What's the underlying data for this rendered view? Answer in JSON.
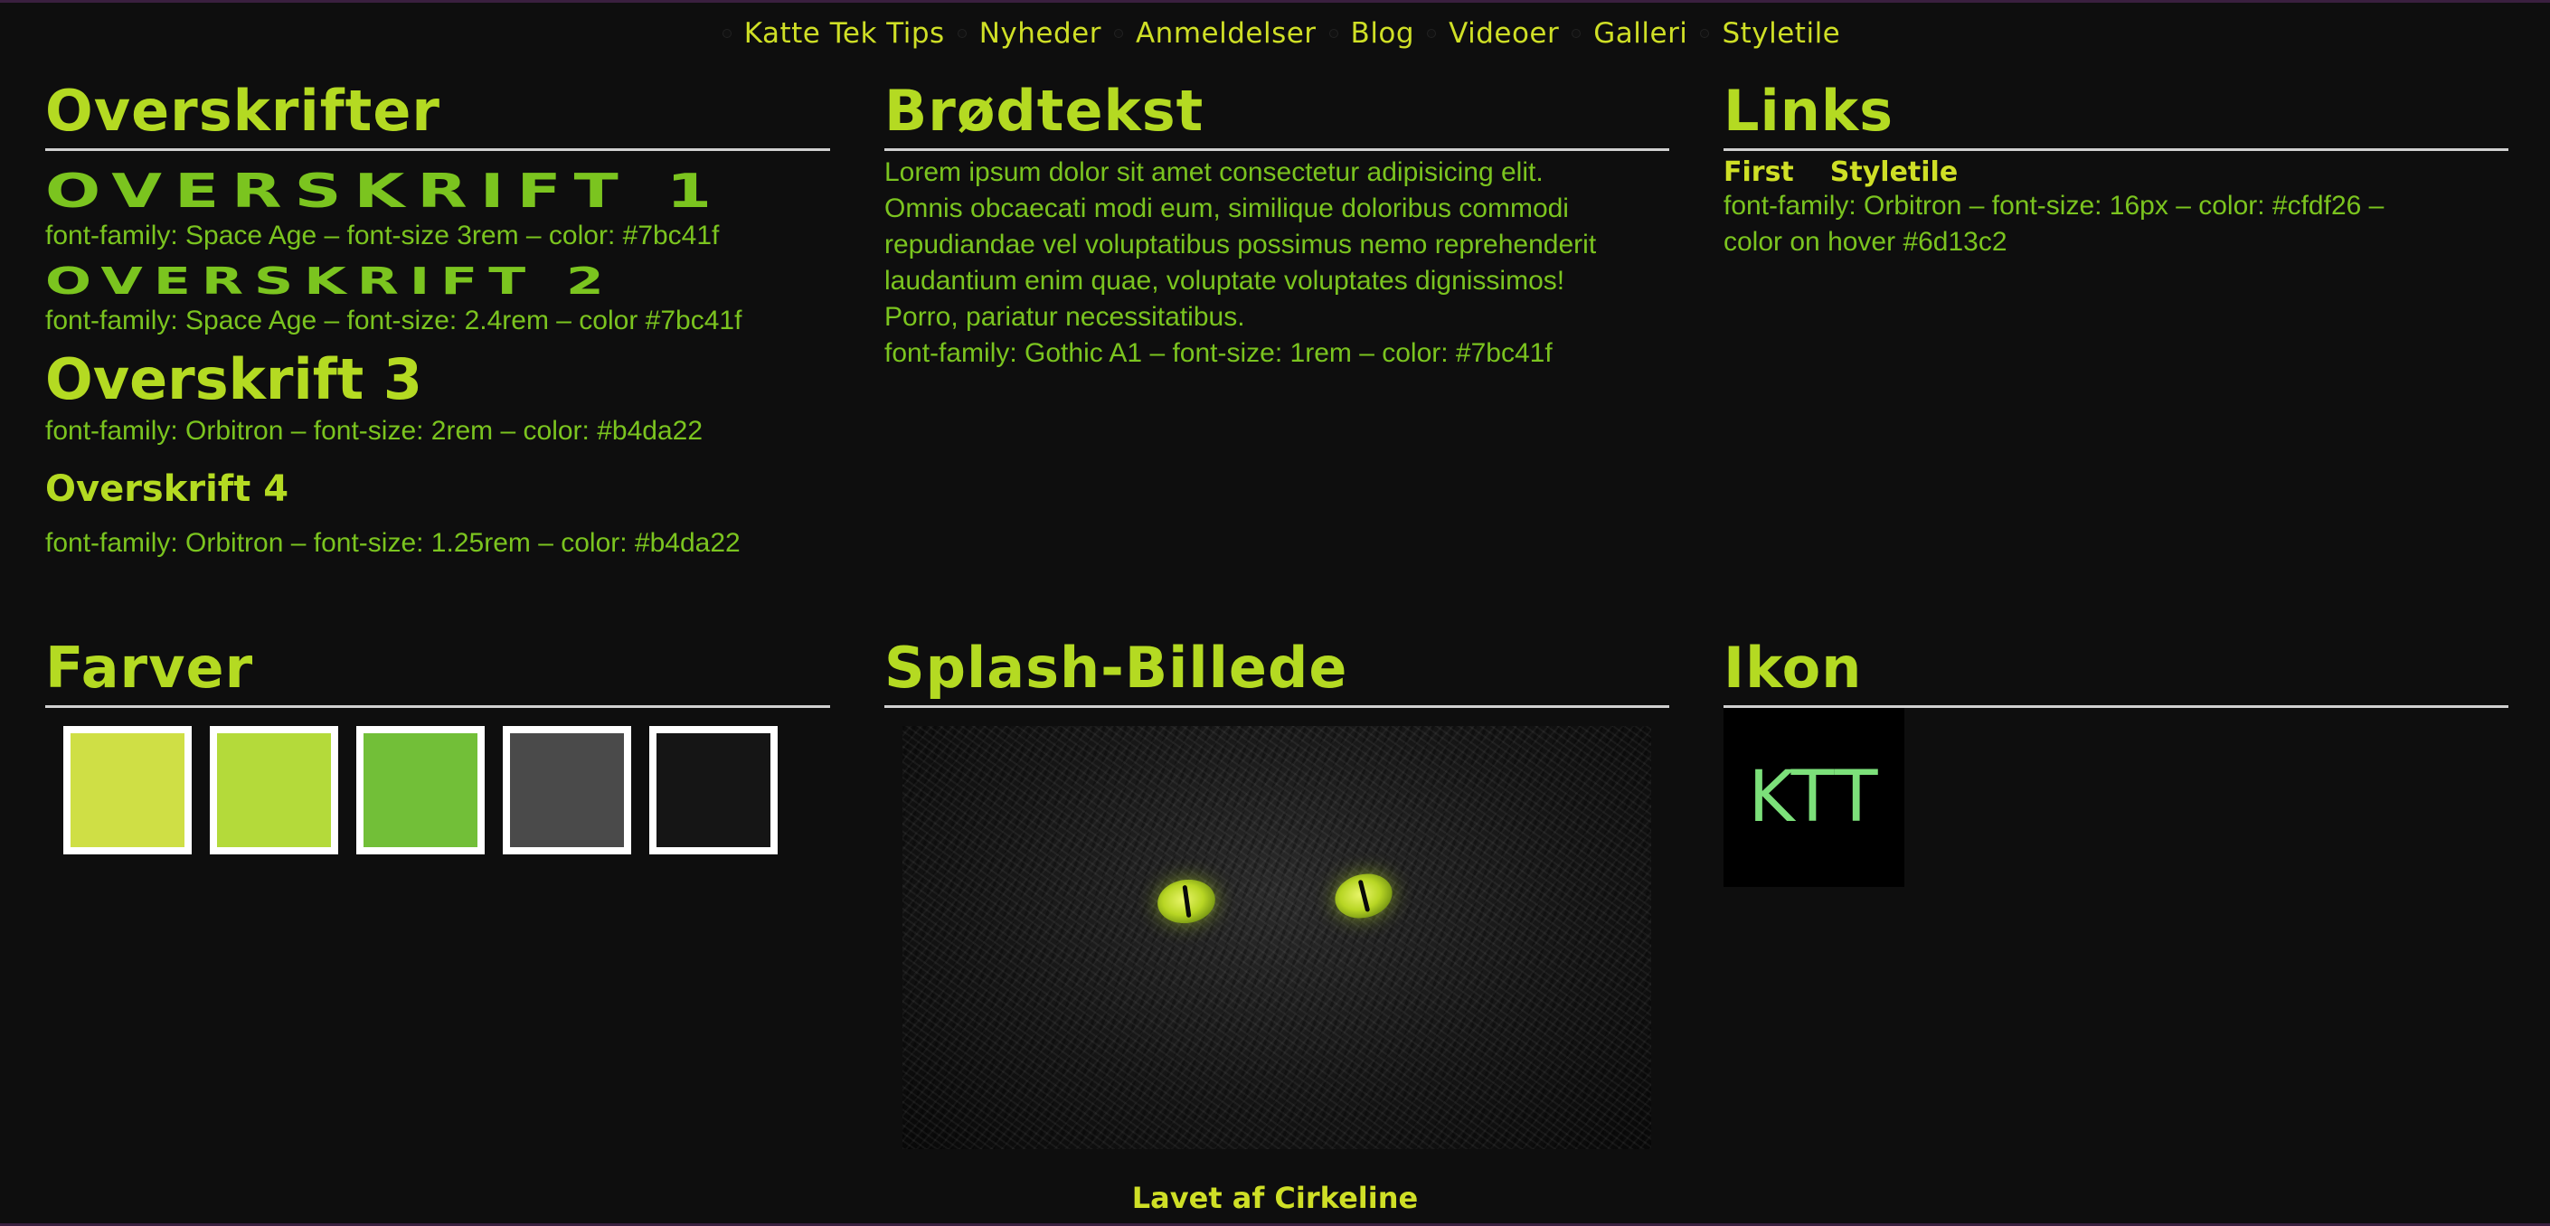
{
  "nav": {
    "items": [
      {
        "label": "Katte Tek Tips"
      },
      {
        "label": "Nyheder"
      },
      {
        "label": "Anmeldelser"
      },
      {
        "label": "Blog"
      },
      {
        "label": "Videoer"
      },
      {
        "label": "Galleri"
      },
      {
        "label": "Styletile"
      }
    ]
  },
  "overskrifter": {
    "title": "Overskrifter",
    "h1": "OVERSKRIFT 1",
    "h1_desc": "font-family: Space Age – font-size 3rem – color: #7bc41f",
    "h2": "OVERSKRIFT 2",
    "h2_desc": "font-family: Space Age – font-size: 2.4rem – color #7bc41f",
    "h3": "Overskrift 3",
    "h3_desc": "font-family: Orbitron – font-size: 2rem – color: #b4da22",
    "h4": "Overskrift 4",
    "h4_desc": "font-family: Orbitron – font-size: 1.25rem – color: #b4da22"
  },
  "brodtekst": {
    "title": "Brødtekst",
    "lines": [
      "Lorem ipsum dolor sit amet consectetur adipisicing elit.",
      "Omnis obcaecati modi eum, similique doloribus commodi",
      "repudiandae vel voluptatibus possimus nemo reprehenderit",
      "laudantium enim quae, voluptate voluptates dignissimos!",
      "Porro, pariatur necessitatibus."
    ],
    "desc": "font-family: Gothic A1 – font-size: 1rem – color: #7bc41f"
  },
  "links": {
    "title": "Links",
    "first": "First",
    "styletile": "Styletile",
    "desc_line1": "font-family: Orbitron – font-size: 16px – color: #cfdf26 –",
    "desc_line2": "color on hover #6d13c2"
  },
  "farver": {
    "title": "Farver",
    "colors": [
      "#cfdf45",
      "#b4da3a",
      "#72bf38",
      "#4a4a4a",
      "#151515"
    ]
  },
  "splash": {
    "title": "Splash-Billede"
  },
  "ikon": {
    "title": "Ikon",
    "text": "KTT"
  },
  "footer": {
    "text": "Lavet af Cirkeline"
  }
}
